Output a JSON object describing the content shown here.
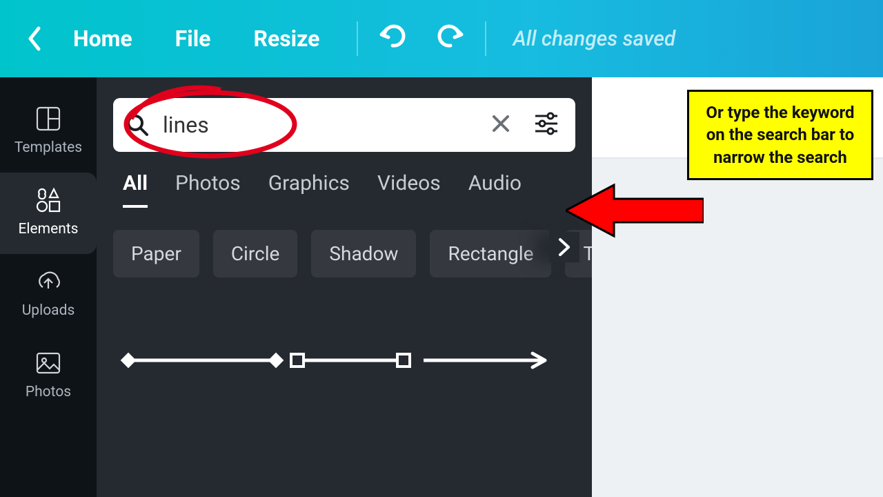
{
  "topbar": {
    "home": "Home",
    "file": "File",
    "resize": "Resize",
    "status": "All changes saved"
  },
  "sidebar": {
    "templates": "Templates",
    "elements": "Elements",
    "uploads": "Uploads",
    "photos": "Photos"
  },
  "search": {
    "value": "lines"
  },
  "tabs": {
    "all": "All",
    "photos": "Photos",
    "graphics": "Graphics",
    "videos": "Videos",
    "audio": "Audio"
  },
  "chips": {
    "c0": "Paper",
    "c1": "Circle",
    "c2": "Shadow",
    "c3": "Rectangle",
    "c4": "Ta"
  },
  "annotation": {
    "callout": "Or type the keyword on the search bar to narrow the search"
  }
}
